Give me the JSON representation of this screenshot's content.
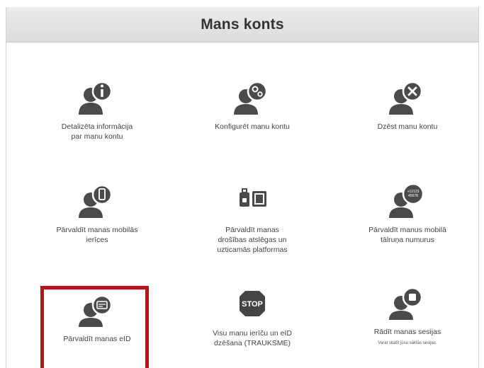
{
  "header": {
    "title": "Mans konts"
  },
  "tiles": [
    {
      "label": "Detalizēta informācija\npar manu kontu",
      "icon": "user-info-icon"
    },
    {
      "label": "Konfigurēt manu kontu",
      "icon": "user-settings-icon"
    },
    {
      "label": "Dzēst manu kontu",
      "icon": "user-delete-icon"
    },
    {
      "label": "Pārvaldīt manas mobilās\nierīces",
      "icon": "user-mobile-icon"
    },
    {
      "label": "Pārvaldīt manas\ndrošības atslēgas un\nuzticamās platformas",
      "icon": "security-keys-icon"
    },
    {
      "label": "Pārvaldīt manus mobilā\ntālruņa numurus",
      "icon": "user-phone-number-icon",
      "badge": "+12123\n45678"
    },
    {
      "label": "Pārvaldīt manas eID",
      "icon": "user-eid-icon"
    },
    {
      "label": "Visu manu ierīču un eID\ndzēšana (TRAUKSME)",
      "icon": "stop-sign-icon",
      "stop_text": "STOP"
    },
    {
      "label": "Rādīt manas sesijas",
      "icon": "user-sessions-icon",
      "sublabel": "Varat skatīt jūsu sāktās sesijas."
    }
  ],
  "colors": {
    "icon": "#4a4a4a",
    "highlight": "#b5141b",
    "stop": "#444444"
  }
}
